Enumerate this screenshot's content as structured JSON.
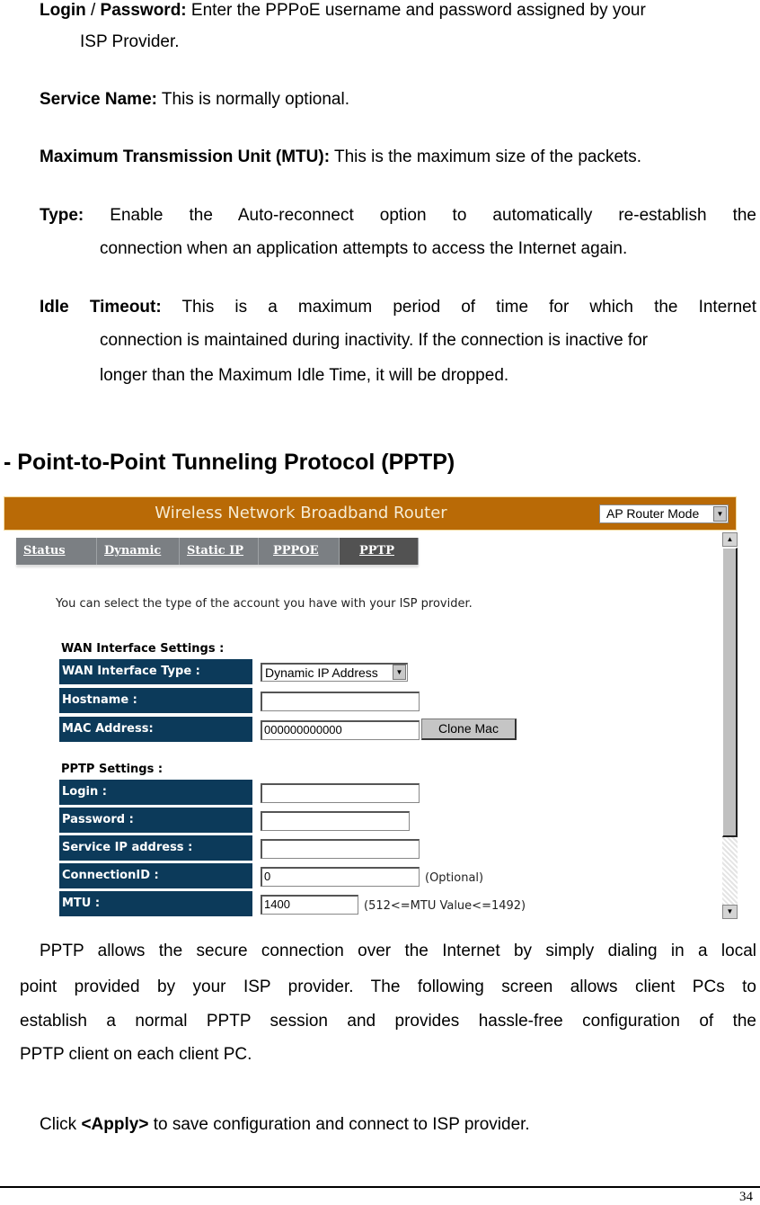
{
  "doc": {
    "paragraphs": {
      "login": {
        "term": "Login",
        "sep": " / ",
        "term2": "Password:",
        "text": " Enter the PPPoE username and password assigned by your",
        "cont": "ISP Provider."
      },
      "service": {
        "term": "Service Name:",
        "text": " This is normally optional."
      },
      "mtu": {
        "term": "Maximum Transmission Unit (MTU):",
        "text": " This is the maximum size of the packets."
      },
      "type": {
        "term": "Type:",
        "text": " Enable the Auto-reconnect option to automatically re-establish the",
        "cont": "connection when an application attempts to access the Internet again."
      },
      "idle": {
        "term": "Idle Timeout:",
        "text": " This is a maximum period of time for which the Internet",
        "cont1": "connection is maintained during inactivity. If the connection is inactive for",
        "cont2": "longer than the Maximum Idle Time, it will be dropped."
      }
    },
    "section_heading": "- Point-to-Point Tunneling Protocol (PPTP)",
    "body": {
      "line1": "PPTP allows the secure connection over the Internet by simply dialing in a local",
      "line2": "point provided by your ISP provider. The following screen allows client PCs to",
      "line3": "establish a normal PPTP session and provides hassle-free configuration of the",
      "line4": "PPTP client on each client PC."
    },
    "apply": {
      "pre": "Click ",
      "term": "<Apply>",
      "post": " to save configuration and connect to ISP provider."
    },
    "page_number": "34"
  },
  "router": {
    "title": "Wireless Network Broadband Router",
    "mode_select": "AP Router Mode",
    "tabs": [
      {
        "label": "Status"
      },
      {
        "label": "Dynamic IP"
      },
      {
        "label": "Static IP"
      },
      {
        "label": "PPPOE"
      },
      {
        "label": "PPTP",
        "active": true
      }
    ],
    "intro": "You can select the type of the account you have with your ISP provider.",
    "wan": {
      "title": "WAN Interface Settings :",
      "type_label": "WAN Interface Type :",
      "type_value": "Dynamic IP Address",
      "hostname_label": "Hostname :",
      "hostname_value": "",
      "mac_label": "MAC Address:",
      "mac_value": "000000000000",
      "clone_button": "Clone Mac"
    },
    "pptp": {
      "title": "PPTP Settings :",
      "login_label": "Login :",
      "login_value": "",
      "password_label": "Password :",
      "password_value": "",
      "service_ip_label": "Service IP address :",
      "service_ip_value": "",
      "connection_id_label": "ConnectionID :",
      "connection_id_value": "0",
      "connection_id_hint": "(Optional)",
      "mtu_label": "MTU :",
      "mtu_value": "1400",
      "mtu_hint": "(512<=MTU Value<=1492)"
    },
    "colors": {
      "banner": "#b96a06",
      "tab": "#7b7f83",
      "tab_active": "#525252",
      "label_bg": "#0c3a5a"
    }
  }
}
